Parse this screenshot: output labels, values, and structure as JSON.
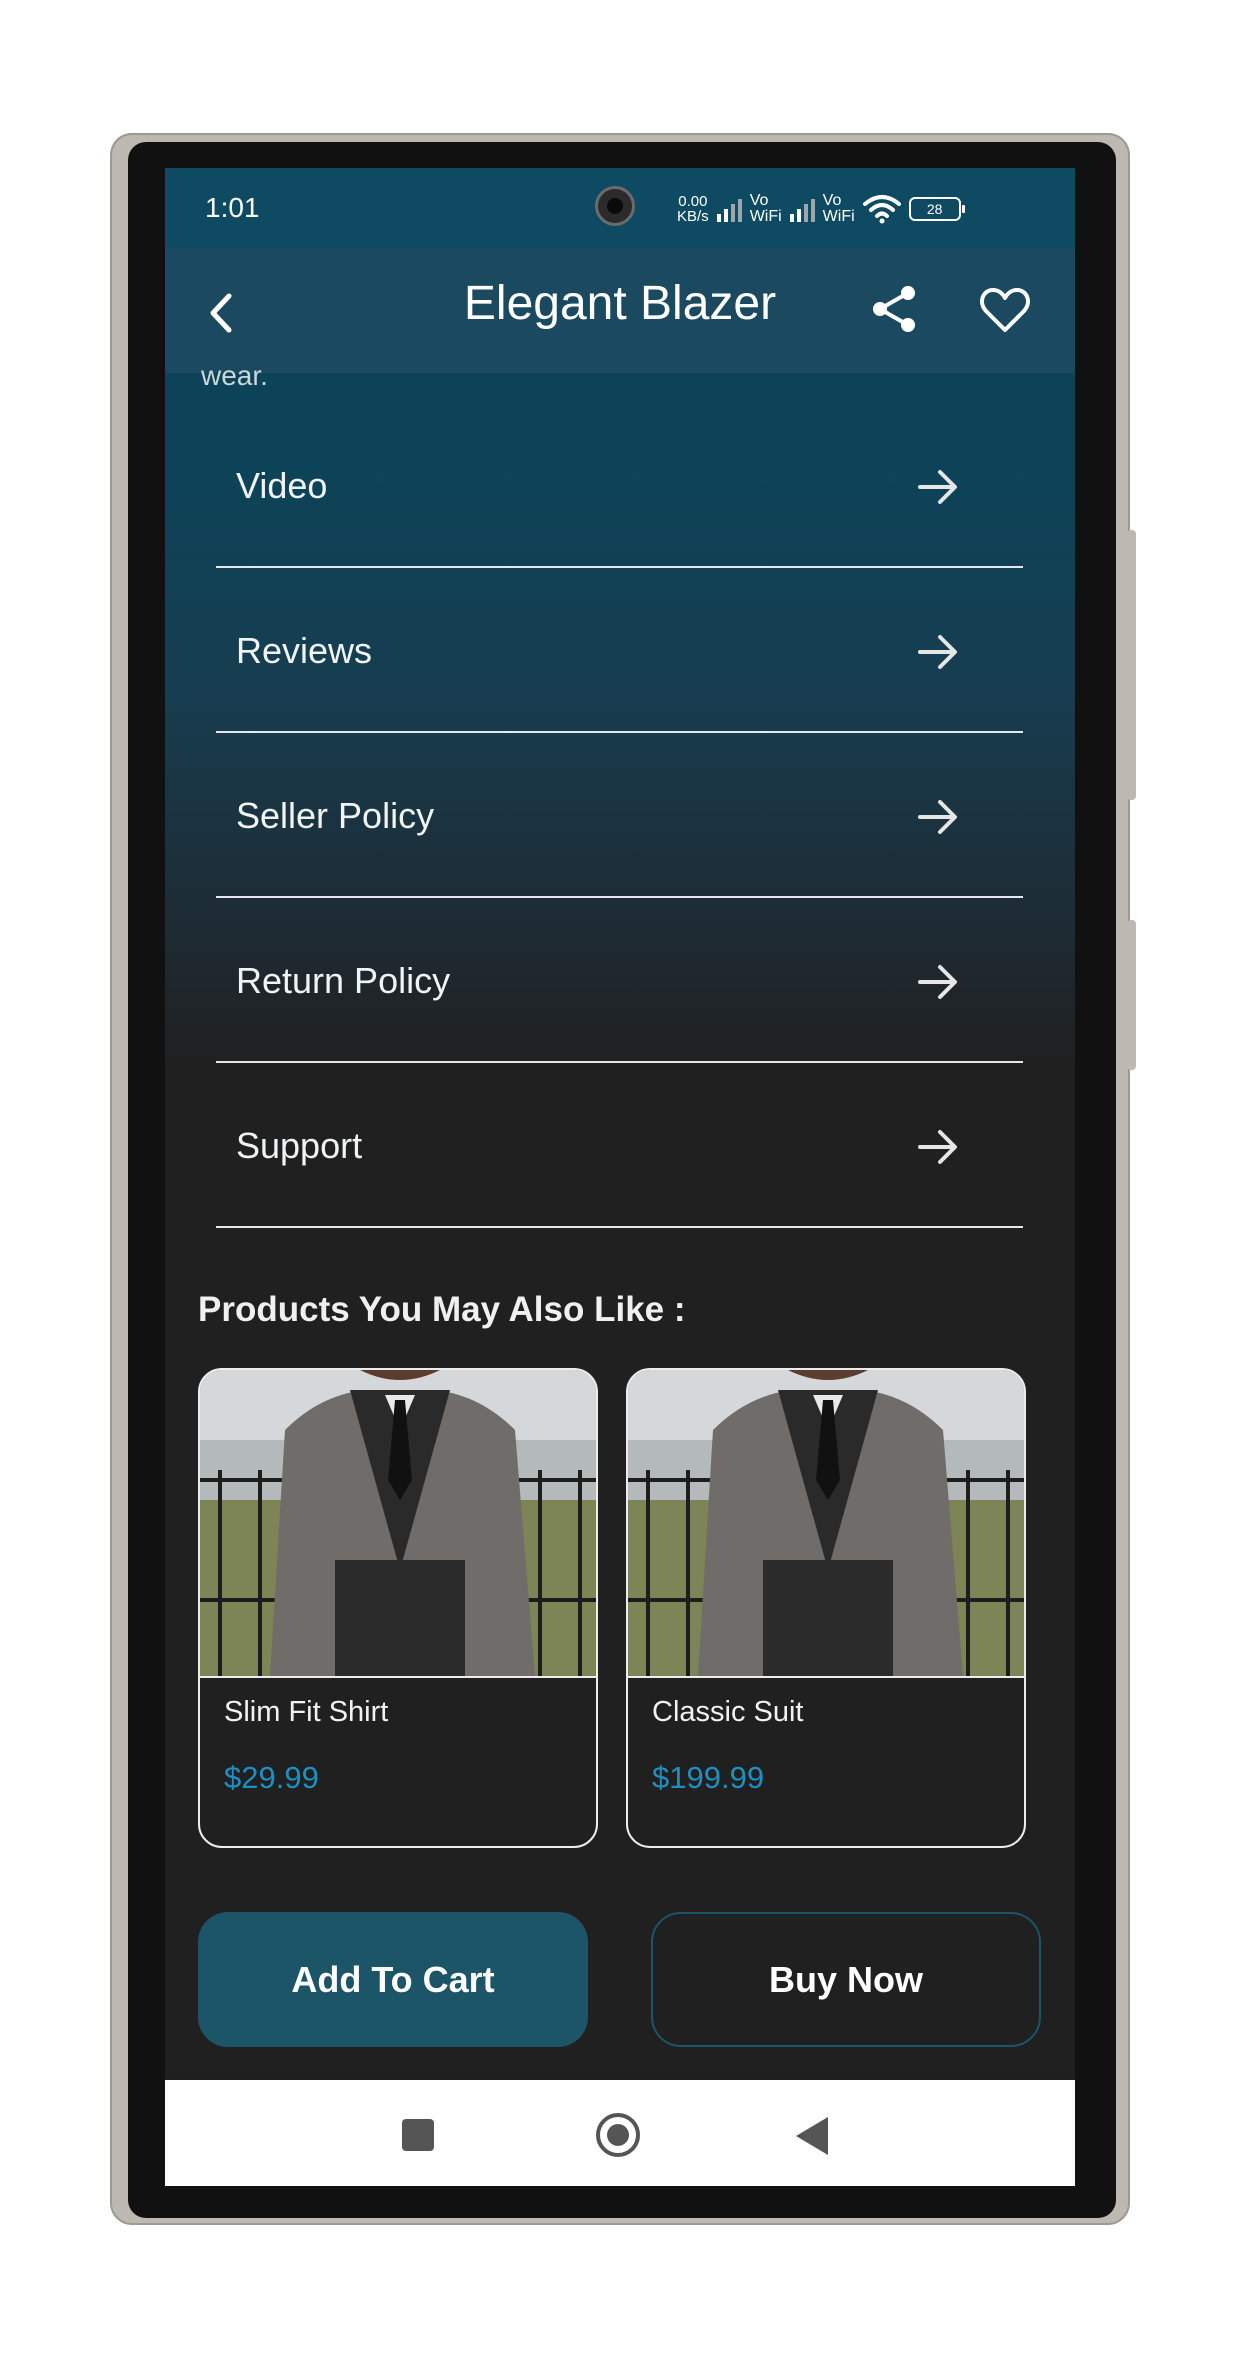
{
  "status_bar": {
    "time": "1:01",
    "net_speed_value": "0.00",
    "net_speed_unit": "KB/s",
    "vowifi_1": "Vo\nWiFi",
    "vowifi_2": "Vo\nWiFi",
    "battery": "28",
    "icons": [
      "camera-cutout",
      "signal-icon",
      "signal-icon",
      "wifi-icon",
      "battery-icon"
    ]
  },
  "app_bar": {
    "title": "Elegant Blazer",
    "icons": [
      "back-icon",
      "share-icon",
      "heart-icon"
    ]
  },
  "description": {
    "cutoff_text": "wear."
  },
  "menu": {
    "items": [
      {
        "label": "Video"
      },
      {
        "label": "Reviews"
      },
      {
        "label": "Seller Policy"
      },
      {
        "label": "Return Policy"
      },
      {
        "label": "Support"
      }
    ],
    "arrow_icon": "arrow-right-icon"
  },
  "related": {
    "title": "Products You May Also Like :",
    "products": [
      {
        "name": "Slim Fit Shirt",
        "price": "$29.99"
      },
      {
        "name": "Classic Suit",
        "price": "$199.99"
      }
    ]
  },
  "actions": {
    "add_to_cart": "Add To Cart",
    "buy_now": "Buy Now"
  },
  "colors": {
    "header": "#1b4a60",
    "primary_button": "#1c5468",
    "price": "#1d8fc2",
    "background": "#202020"
  },
  "nav_bar": {
    "icons": [
      "recents-icon",
      "home-icon",
      "back-triangle-icon"
    ]
  }
}
